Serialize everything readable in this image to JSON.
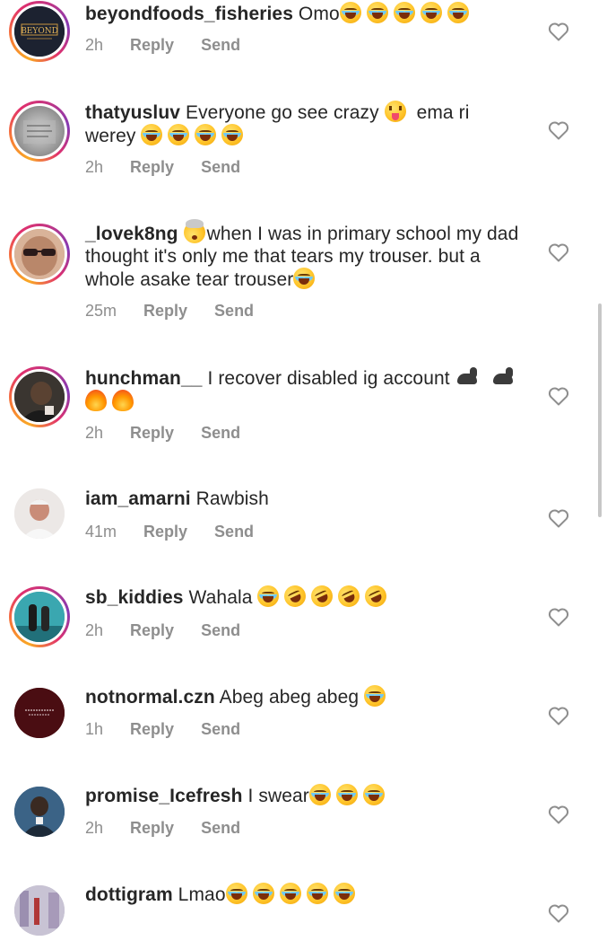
{
  "comments": [
    {
      "username": "beyondfoods_fisheries",
      "text": "Omo",
      "emojis_after": [
        "laugh",
        "laugh",
        "laugh",
        "laugh",
        "laugh"
      ],
      "time": "2h",
      "avatar": {
        "kind": "brand-logo",
        "logo_text": "BEYOND",
        "story_ring": true
      }
    },
    {
      "username": "thatyusluv",
      "text": "Everyone go see crazy",
      "emoji_mid": "tongue",
      "text_after": "ema ri werey",
      "emojis_after": [
        "laugh",
        "laugh",
        "laugh",
        "laugh"
      ],
      "time": "2h",
      "avatar": {
        "kind": "gray-photo",
        "story_ring": true
      }
    },
    {
      "username": "_lovek8ng",
      "emoji_mid": "mindblown",
      "text": "when I was in primary school my dad thought it's only me that tears my trouser. but a whole asake tear trouser",
      "emojis_after": [
        "laugh"
      ],
      "time": "25m",
      "avatar": {
        "kind": "face-sunglasses",
        "story_ring": true
      }
    },
    {
      "username": "hunchman__",
      "text": "I recover disabled ig account",
      "emojis_after": [
        "muscle",
        "muscle",
        "fire",
        "fire"
      ],
      "time": "2h",
      "avatar": {
        "kind": "dark-photo",
        "story_ring": true
      }
    },
    {
      "username": "iam_amarni",
      "text": "Rawbish",
      "emojis_after": [],
      "time": "41m",
      "avatar": {
        "kind": "light-photo",
        "story_ring": false
      }
    },
    {
      "username": "sb_kiddies",
      "text": "Wahala",
      "emojis_after": [
        "laugh",
        "rofl",
        "rofl",
        "rofl",
        "rofl"
      ],
      "time": "2h",
      "avatar": {
        "kind": "teal-photo",
        "story_ring": true
      }
    },
    {
      "username": "notnormal.czn",
      "text": "Abeg abeg abeg",
      "emojis_after": [
        "laugh"
      ],
      "time": "1h",
      "avatar": {
        "kind": "maroon-text",
        "story_ring": false
      }
    },
    {
      "username": "promise_Icefresh",
      "text": "I swear",
      "emojis_after": [
        "laugh",
        "laugh",
        "laugh"
      ],
      "time": "2h",
      "avatar": {
        "kind": "blue-photo",
        "story_ring": false
      }
    },
    {
      "username": "dottigram",
      "text": "Lmao",
      "emojis_after": [
        "laugh",
        "laugh",
        "laugh",
        "laugh",
        "laugh"
      ],
      "time": "",
      "avatar": {
        "kind": "street-photo",
        "story_ring": false
      }
    }
  ],
  "labels": {
    "reply": "Reply",
    "send": "Send"
  },
  "icons": {
    "like": "heart-outline-icon"
  },
  "colors": {
    "text": "#262626",
    "secondary": "#8e8e8e",
    "scrollbar": "#c7c7c7"
  }
}
